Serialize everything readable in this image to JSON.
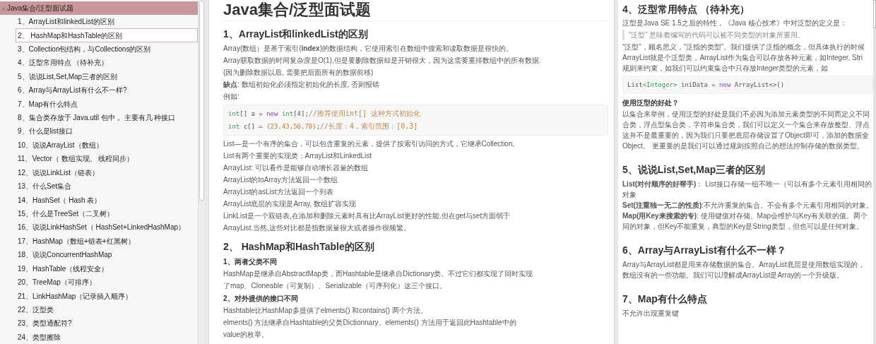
{
  "sidebar": {
    "outline": {
      "title": "Java集合/泛型面试题",
      "expanded": true,
      "selected": true,
      "children": [
        {
          "label": "1、ArrayList和linkedList的区别",
          "focused": false
        },
        {
          "label": "2、 HashMap和HashTable的区别",
          "focused": true
        },
        {
          "label": "3、Collection包结构，与Collections的区别",
          "focused": false
        },
        {
          "label": "4、泛型常用特点 （待补充）",
          "focused": false
        },
        {
          "label": "5、说说List,Set,Map三者的区别",
          "focused": false
        },
        {
          "label": "6、Array与ArrayList有什么不一样?",
          "focused": false
        },
        {
          "label": "7、Map有什么特点",
          "focused": false
        },
        {
          "label": "8、集合类存放于 Java.util 包中， 主要有几 种接口",
          "focused": false
        },
        {
          "label": "9、什么是list接口",
          "focused": false
        },
        {
          "label": "10、说说ArrayList（数组）",
          "focused": false
        },
        {
          "label": "11、Vector（ 数组实现、 线程同步）",
          "focused": false
        },
        {
          "label": "12、说说LinkList（链表）",
          "focused": false
        },
        {
          "label": "13、什么Set集合",
          "focused": false
        },
        {
          "label": "14、HashSet（ Hash 表）",
          "focused": false
        },
        {
          "label": "15、什么是TreeSet（二叉树）",
          "focused": false
        },
        {
          "label": "16、说说LinkHashSet（ HashSet+LinkedHashMap）",
          "focused": false
        },
        {
          "label": "17、HashMap（数组+链表+红黑树）",
          "focused": false
        },
        {
          "label": "18、说说ConcurrentHashMap",
          "focused": false
        },
        {
          "label": "19、HashTable（线程安全）",
          "focused": false
        },
        {
          "label": "20、TreeMap（可排序）",
          "focused": false
        },
        {
          "label": "21、LinkHashMap（记录插入顺序）",
          "focused": false
        },
        {
          "label": "22、泛型类",
          "focused": false
        },
        {
          "label": "23、类型通配符?",
          "focused": false
        },
        {
          "label": "24、类型擦除",
          "focused": false
        }
      ]
    }
  },
  "middle_page": {
    "title": "Java集合/泛型面试题",
    "blocks": [
      {
        "kind": "h2",
        "text": "1、ArrayList和linkedList的区别"
      },
      {
        "kind": "p",
        "lines": [
          "Array(数组）是基于索引(**index**)的数据结构，它使用索引在数组中搜索和读取数据是很快的。"
        ]
      },
      {
        "kind": "p",
        "lines": [
          "Array获取数据的时间复杂度是O(1),但是要删除数据却是开销很大，因为这需要重排数组中的所有数据."
        ]
      },
      {
        "kind": "p",
        "lines": [
          "(因为删除数据以后, 需要把后面所有的数据前移)"
        ]
      },
      {
        "kind": "p",
        "lines": [
          "**缺点**: 数组初始化必须指定初始化的长度, 否则报错"
        ]
      },
      {
        "kind": "p",
        "lines": [
          "例如:"
        ]
      },
      {
        "kind": "code",
        "lines": [
          [
            {
              "kind": "type",
              "text": "int"
            },
            {
              "kind": "plain",
              "text": "[] a = "
            },
            {
              "kind": "keyword",
              "text": "new"
            },
            {
              "kind": "type",
              "text": " int"
            },
            {
              "kind": "plain",
              "text": "[4];"
            },
            {
              "kind": "comment",
              "text": "//推荐使用int[] 这种方式初始化"
            }
          ],
          [
            {
              "kind": "type",
              "text": "int"
            },
            {
              "kind": "plain",
              "text": " c[] = "
            },
            {
              "kind": "number",
              "text": "{23,43,56,78}"
            },
            {
              "kind": "plain",
              "text": ";"
            },
            {
              "kind": "comment",
              "text": "//长度：4，索引范围：[0,3]"
            }
          ]
        ]
      },
      {
        "kind": "p",
        "lines": [
          "List—是一个有序的集合，可以包含重复的元素，提供了按索引访问的方式，它继承Collection。"
        ]
      },
      {
        "kind": "p",
        "lines": [
          "List有两个重要的实现类：ArrayList和LinkedList"
        ]
      },
      {
        "kind": "p",
        "lines": [
          "ArrayList: 可以看作是能够自动增长容量的数组"
        ]
      },
      {
        "kind": "p",
        "lines": [
          "ArrayList的toArray方法返回一个数组"
        ]
      },
      {
        "kind": "p",
        "lines": [
          "ArrayList的asList方法返回一个列表"
        ]
      },
      {
        "kind": "p",
        "lines": [
          "ArrayList底层的实现是Array, 数组扩容实现"
        ]
      },
      {
        "kind": "p",
        "lines": [
          "LinkList是一个双链表,在添加和删除元素时具有比ArrayList更好的性能.但在get与set方面弱于"
        ]
      },
      {
        "kind": "p",
        "lines": [
          "ArrayList.当然,这些对比都是指数据量很大或者操作很频繁。"
        ]
      },
      {
        "kind": "h2",
        "text": "2、 HashMap和HashTable的区别"
      },
      {
        "kind": "h3",
        "text": "1、两者父类不同"
      },
      {
        "kind": "p",
        "lines": [
          "HashMap是继承自AbstractMap类，而Hashtable是继承自Dictionary类。不过它们都实现了同时实现"
        ]
      },
      {
        "kind": "p",
        "lines": [
          "了map、Cloneable（可复制）、Serializable（可序列化）这三个接口。"
        ]
      },
      {
        "kind": "h3",
        "text": "2、对外提供的接口不同"
      },
      {
        "kind": "p",
        "lines": [
          "Hashtable比HashMap多提供了elments() 和contains() 两个方法。"
        ]
      },
      {
        "kind": "p",
        "lines": [
          " elments() 方法继承自Hashtable的父类Dictionnary。elements() 方法用于返回此Hashtable中的"
        ]
      },
      {
        "kind": "p",
        "lines": [
          "value的枚举。"
        ]
      }
    ]
  },
  "right_page": {
    "blocks": [
      {
        "kind": "h2",
        "text": "4、泛型常用特点 （待补充）"
      },
      {
        "kind": "p",
        "lines": [
          "泛型是Java SE 1.5之后的特性，《Java 核心技术》中对泛型的定义是："
        ]
      },
      {
        "kind": "quote",
        "text": "“泛型” 意味着编写的代码可以被不同类型的对象所重用。"
      },
      {
        "kind": "p",
        "lines": [
          "“泛型”，顾名思义，“泛指的类型”。我们提供了泛指的概念，但具体执行的时候",
          "ArrayList就是个泛型类，ArrayList作为集合可以存放各种元素，如Integer, Stri",
          "规则来约束，如我们可以约束集合中只存放Integer类型的元素，如"
        ]
      },
      {
        "kind": "code",
        "lines": [
          [
            {
              "kind": "plain",
              "text": "List"
            },
            {
              "kind": "type",
              "text": "<Integer>"
            },
            {
              "kind": "plain",
              "text": " iniData = "
            },
            {
              "kind": "keyword",
              "text": "new"
            },
            {
              "kind": "plain",
              "text": " ArrayList<>()"
            }
          ]
        ]
      },
      {
        "kind": "h3",
        "text": "使用泛型的好处？"
      },
      {
        "kind": "p",
        "lines": [
          "以集合来举例，使用泛型的好处是我们不必因为添加元素类型的不同而定义不同",
          "合类，浮点型集合类，字符串集合类，我们可以定义一个集合来存放整型、浮点",
          "这并不是最重要的，因为我们只要把底层存储设置了Object即可，添加的数据全",
          "Object。 更重要的是我们可以通过规则按照自己的想法控制存储的数据类型。"
        ]
      },
      {
        "kind": "h2",
        "text": "5、说说List,Set,Map三者的区别"
      },
      {
        "kind": "p",
        "lines": [
          "**List(对付顺序的好帮手)**： List接口存储一组不唯一（可以有多个元素引用相同的",
          "对象"
        ]
      },
      {
        "kind": "p",
        "lines": [
          "**Set(注重独一无二的性质)**:不允许重复的集合。不会有多个元素引用相同的对象。"
        ]
      },
      {
        "kind": "p",
        "lines": [
          "**Map(用Key来搜索的专)**: 使用键值对存储。Map会维护与Key有关联的值。两个",
          "同的对象，但Key不能重复，典型的Key是String类型，但也可以是任何对象。"
        ]
      },
      {
        "kind": "h2",
        "text": "6、Array与ArrayList有什么不一样？"
      },
      {
        "kind": "p",
        "lines": [
          "Array与ArrayList都是用来存储数据的集合。ArrayList底层是使用数组实现的，",
          "数组没有的一些功能。我们可以理解成ArrayList是Array的一个升级版。"
        ]
      },
      {
        "kind": "h2",
        "text": "7、Map有什么特点"
      },
      {
        "kind": "p",
        "lines": [
          "不允许出现重复键"
        ]
      }
    ]
  }
}
